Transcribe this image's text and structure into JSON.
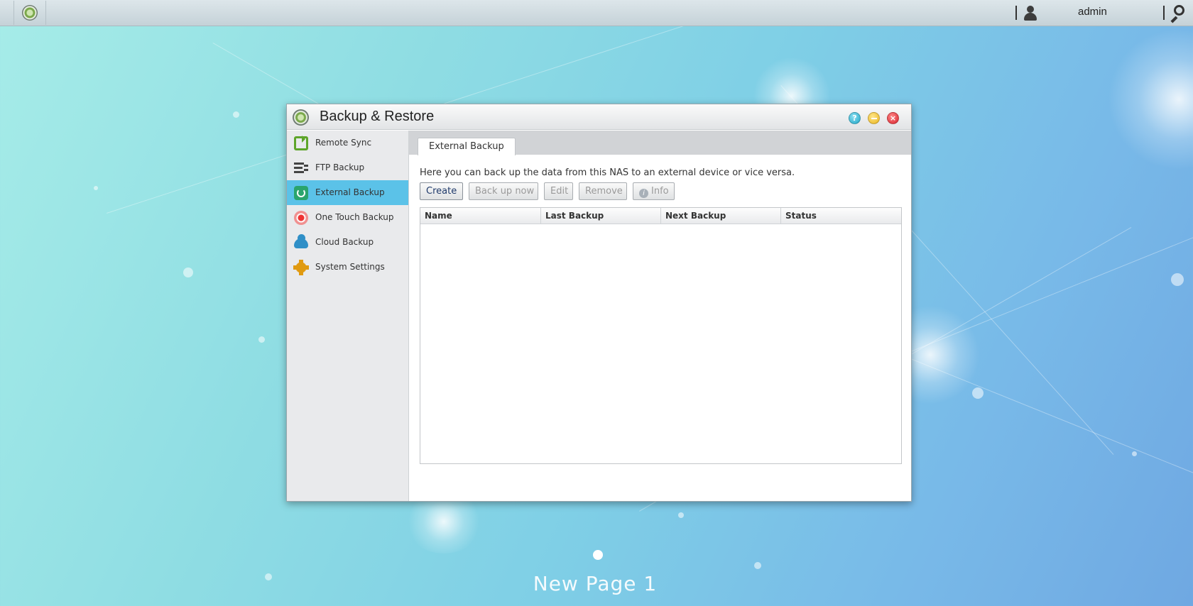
{
  "topbar": {
    "username": "admin"
  },
  "window": {
    "title": "Backup & Restore",
    "buttons": {
      "help": "?",
      "minimize": "",
      "close": "×"
    }
  },
  "sidebar": {
    "items": [
      {
        "label": "Remote Sync",
        "icon": "remote-sync-icon"
      },
      {
        "label": "FTP Backup",
        "icon": "ftp-backup-icon"
      },
      {
        "label": "External Backup",
        "icon": "external-backup-icon",
        "active": true
      },
      {
        "label": "One Touch Backup",
        "icon": "one-touch-backup-icon"
      },
      {
        "label": "Cloud Backup",
        "icon": "cloud-backup-icon"
      },
      {
        "label": "System Settings",
        "icon": "system-settings-icon"
      }
    ]
  },
  "content": {
    "tab": "External Backup",
    "description": "Here you can back up the data from this NAS to an external device or vice versa.",
    "toolbar": {
      "create": "Create",
      "backup_now": "Back up now",
      "edit": "Edit",
      "remove": "Remove",
      "info": "Info"
    },
    "table": {
      "columns": [
        "Name",
        "Last Backup",
        "Next Backup",
        "Status"
      ],
      "rows": []
    }
  },
  "desktop": {
    "page_label": "New Page 1"
  },
  "colors": {
    "accent_active": "#5bc2e8",
    "sidebar_bg": "#e9eaec",
    "desktop_gradient_start": "#a6ece8",
    "desktop_gradient_end": "#6fa8e2"
  }
}
